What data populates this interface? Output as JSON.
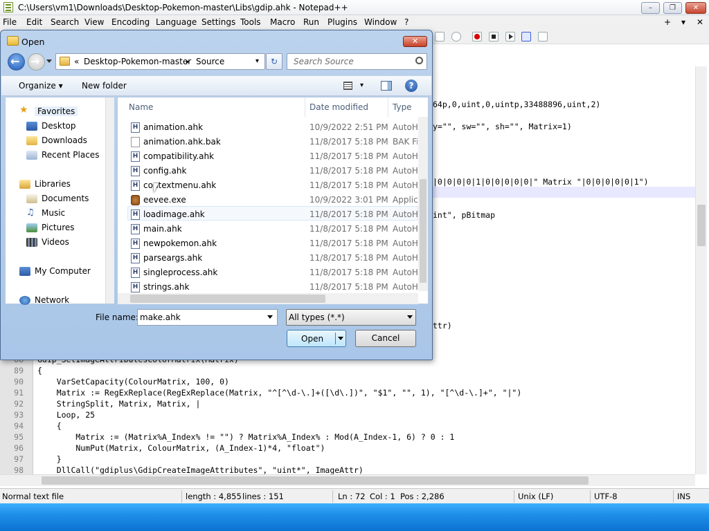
{
  "npp": {
    "title": "C:\\Users\\vm1\\Downloads\\Desktop-Pokemon-master\\Libs\\gdip.ahk - Notepad++",
    "window_min": "–",
    "window_max": "❐",
    "window_close": "✕",
    "menu": [
      "File",
      "Edit",
      "Search",
      "View",
      "Encoding",
      "Language",
      "Settings",
      "Tools",
      "Macro",
      "Run",
      "Plugins",
      "Window",
      "?"
    ],
    "menu_right_plus": "+",
    "menu_right_down": "▾",
    "menu_right_x": "✕",
    "code_fragments": [
      "64p,0,uint,0,uintp,33488896,uint,2)",
      "y=\"\", sw=\"\", sh=\"\", Matrix=1)",
      "|0|0|0|0|1|0|0|0|0|0|\" Matrix \"|0|0|0|0|0|1\")",
      "int\", pBitmap",
      "ttr)"
    ],
    "code_lines": [
      {
        "n": "88",
        "text": "Gdip_SetImageAttributesColorMatrix(Matrix)"
      },
      {
        "n": "89",
        "text": "{"
      },
      {
        "n": "90",
        "text": "    VarSetCapacity(ColourMatrix, 100, 0)"
      },
      {
        "n": "91",
        "text": "    Matrix := RegExReplace(RegExReplace(Matrix, \"^[^\\d-\\.]+([\\d\\.])\", \"$1\", \"\", 1), \"[^\\d-\\.]+\", \"|\")"
      },
      {
        "n": "92",
        "text": "    StringSplit, Matrix, Matrix, |"
      },
      {
        "n": "93",
        "text": "    Loop, 25"
      },
      {
        "n": "94",
        "text": "    {"
      },
      {
        "n": "95",
        "text": "        Matrix := (Matrix%A_Index% != \"\") ? Matrix%A_Index% : Mod(A_Index-1, 6) ? 0 : 1"
      },
      {
        "n": "96",
        "text": "        NumPut(Matrix, ColourMatrix, (A_Index-1)*4, \"float\")"
      },
      {
        "n": "97",
        "text": "    }"
      },
      {
        "n": "98",
        "text": "    DllCall(\"gdiplus\\GdipCreateImageAttributes\", \"uint*\", ImageAttr)"
      }
    ],
    "status": {
      "type": "Normal text file",
      "length": "length : 4,855",
      "lines": "lines : 151",
      "ln": "Ln : 72",
      "col": "Col : 1",
      "pos": "Pos : 2,286",
      "eol": "Unix (LF)",
      "encoding": "UTF-8",
      "mode": "INS"
    }
  },
  "dialog": {
    "title": "Open",
    "close": "✕",
    "breadcrumb_sep": "«",
    "breadcrumb": [
      "Desktop-Pokemon-master",
      "Source"
    ],
    "crumb_arrow": "▸",
    "addr_drop": "▾",
    "refresh": "↻",
    "search_placeholder": "Search Source",
    "organize": "Organize ▾",
    "new_folder": "New folder",
    "view_drop": "▾",
    "help": "?",
    "nav": {
      "favorites": "Favorites",
      "desktop": "Desktop",
      "downloads": "Downloads",
      "recent": "Recent Places",
      "libraries": "Libraries",
      "documents": "Documents",
      "music": "Music",
      "pictures": "Pictures",
      "videos": "Videos",
      "computer": "My Computer",
      "network": "Network"
    },
    "columns": {
      "name": "Name",
      "date": "Date modified",
      "type": "Type"
    },
    "files": [
      {
        "name": "animation.ahk",
        "date": "10/9/2022 2:51 PM",
        "type": "AutoH",
        "icon": "ahk"
      },
      {
        "name": "animation.ahk.bak",
        "date": "11/8/2017 5:18 PM",
        "type": "BAK Fi",
        "icon": "blank"
      },
      {
        "name": "compatibility.ahk",
        "date": "11/8/2017 5:18 PM",
        "type": "AutoH",
        "icon": "ahk"
      },
      {
        "name": "config.ahk",
        "date": "11/8/2017 5:18 PM",
        "type": "AutoH",
        "icon": "ahk"
      },
      {
        "name": "contextmenu.ahk",
        "date": "11/8/2017 5:18 PM",
        "type": "AutoH",
        "icon": "ahk"
      },
      {
        "name": "eevee.exe",
        "date": "10/9/2022 3:01 PM",
        "type": "Applic",
        "icon": "exe"
      },
      {
        "name": "loadimage.ahk",
        "date": "11/8/2017 5:18 PM",
        "type": "AutoH",
        "icon": "ahk"
      },
      {
        "name": "main.ahk",
        "date": "11/8/2017 5:18 PM",
        "type": "AutoH",
        "icon": "ahk"
      },
      {
        "name": "newpokemon.ahk",
        "date": "11/8/2017 5:18 PM",
        "type": "AutoH",
        "icon": "ahk"
      },
      {
        "name": "parseargs.ahk",
        "date": "11/8/2017 5:18 PM",
        "type": "AutoH",
        "icon": "ahk"
      },
      {
        "name": "singleprocess.ahk",
        "date": "11/8/2017 5:18 PM",
        "type": "AutoH",
        "icon": "ahk"
      },
      {
        "name": "strings.ahk",
        "date": "11/8/2017 5:18 PM",
        "type": "AutoH",
        "icon": "ahk"
      }
    ],
    "file_name_label": "File name:",
    "file_name_value": "make.ahk",
    "file_type": "All types (*.*)",
    "open": "Open",
    "cancel": "Cancel"
  }
}
